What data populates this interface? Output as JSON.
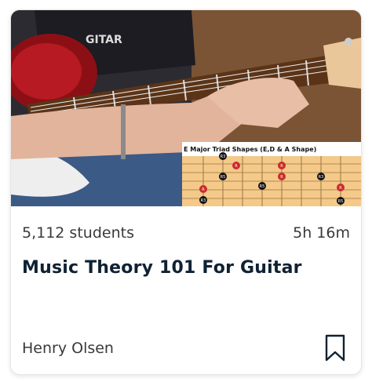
{
  "course": {
    "students": "5,112 students",
    "duration": "5h 16m",
    "title": "Music Theory 101 For Guitar",
    "author": "Henry Olsen"
  },
  "thumbnail": {
    "shirt_text": "GITAR",
    "chart_title": "E Major Triad Shapes (E,D & A Shape)",
    "chart_labels": [
      "R3",
      "R",
      "R5",
      "R",
      "R",
      "R3",
      "R",
      "R5",
      "R",
      "R3",
      "R5"
    ]
  },
  "icons": {
    "bookmark": "bookmark-icon"
  },
  "colors": {
    "title": "#0f2233",
    "meta": "#3a3a3a",
    "accent": "#cc2b2b"
  }
}
